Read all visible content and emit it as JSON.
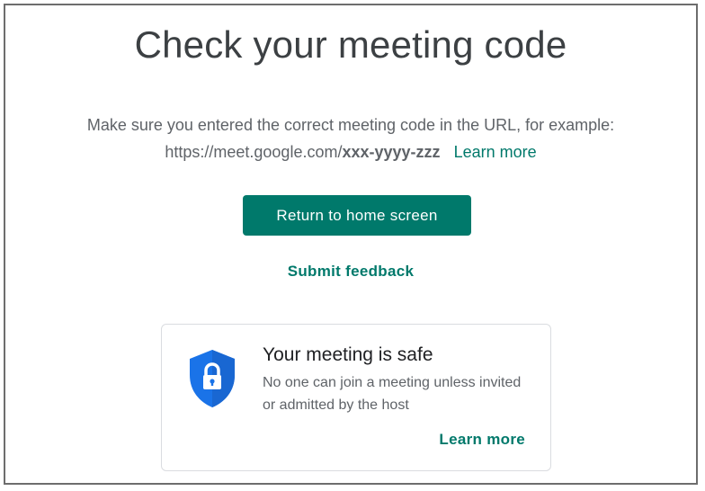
{
  "heading": "Check your meeting code",
  "message": {
    "line1": "Make sure you entered the correct meeting code in the URL, for example:",
    "url_prefix": "https://meet.google.com/",
    "url_code": "xxx-yyyy-zzz",
    "learn_more": "Learn more"
  },
  "actions": {
    "return_home": "Return to home screen",
    "submit_feedback": "Submit feedback"
  },
  "safety_card": {
    "title": "Your meeting is safe",
    "body": "No one can join a meeting unless invited or admitted by the host",
    "learn_more": "Learn more",
    "icon": "shield-lock-icon"
  },
  "colors": {
    "accent": "#00796b",
    "shield": "#1a73e8",
    "title_text": "#3c4043",
    "body_text": "#5f6368"
  }
}
